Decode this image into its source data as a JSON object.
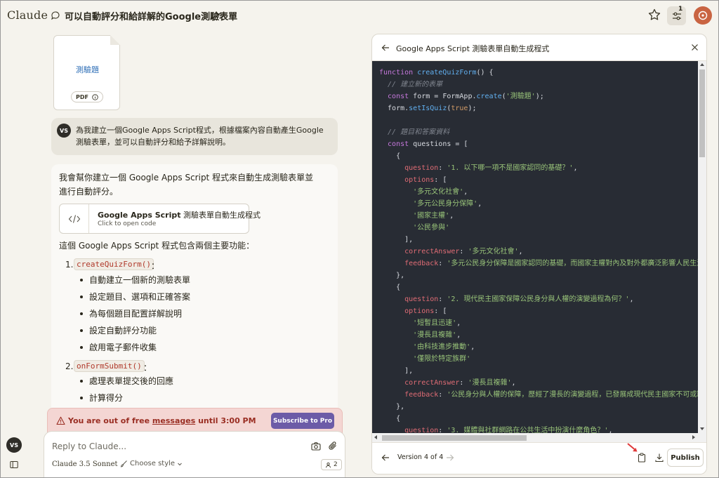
{
  "app": {
    "logo": "Claude"
  },
  "header": {
    "chat_title": "可以自動評分和給詳解的Google測驗表單",
    "settings_badge": "1"
  },
  "attachment": {
    "title": "測驗題",
    "type": "PDF"
  },
  "user": {
    "initials": "VS",
    "message": "為我建立一個Google Apps Script程式，根據檔案內容自動產生Google測驗表單，並可以自動評分和給予詳解說明。"
  },
  "assistant": {
    "intro": "我會幫你建立一個 Google Apps Script 程式來自動生成測驗表單並進行自動評分。",
    "artifact_card": {
      "title_bold": "Google Apps Script",
      "title_rest": "測驗表單自動生成程式",
      "subtitle": "Click to open code"
    },
    "features_intro": "這個 Google Apps Script 程式包含兩個主要功能：",
    "functions": [
      {
        "num": "1.",
        "name": "createQuizForm()",
        "colon": "：",
        "bullets": [
          "自動建立一個新的測驗表單",
          "設定題目、選項和正確答案",
          "為每個題目配置詳解說明",
          "設定自動評分功能",
          "啟用電子郵件收集"
        ]
      },
      {
        "num": "2.",
        "name": "onFormSubmit()",
        "colon": "：",
        "bullets": [
          "處理表單提交後的回應",
          "計算得分"
        ]
      }
    ]
  },
  "warning": {
    "before": "You are out of free ",
    "link": "messages",
    "after": " until 3:00 PM",
    "button": "Subscribe to Pro"
  },
  "composer": {
    "placeholder": "Reply to Claude...",
    "model": "Claude 3.5 Sonnet",
    "style": "Choose style",
    "count": "2"
  },
  "panel": {
    "title": "Google Apps Script 測驗表單自動生成程式",
    "version": "Version 4 of 4",
    "publish": "Publish"
  },
  "code_lines": [
    [
      [
        "k",
        "function "
      ],
      [
        "f",
        "createQuizForm"
      ],
      [
        "t",
        "() {"
      ]
    ],
    [
      [
        "c",
        "  // 建立新的表單"
      ]
    ],
    [
      [
        "k",
        "  const "
      ],
      [
        "t",
        "form = FormApp."
      ],
      [
        "f",
        "create"
      ],
      [
        "t",
        "("
      ],
      [
        "s",
        "'測驗題'"
      ],
      [
        "t",
        ");"
      ]
    ],
    [
      [
        "t",
        "  form."
      ],
      [
        "f",
        "setIsQuiz"
      ],
      [
        "t",
        "("
      ],
      [
        "b",
        "true"
      ],
      [
        "t",
        ");"
      ]
    ],
    [
      [
        "t",
        ""
      ]
    ],
    [
      [
        "c",
        "  // 題目和答案資料"
      ]
    ],
    [
      [
        "k",
        "  const "
      ],
      [
        "t",
        "questions = ["
      ]
    ],
    [
      [
        "t",
        "    {"
      ]
    ],
    [
      [
        "p",
        "      question"
      ],
      [
        "t",
        ": "
      ],
      [
        "s",
        "'1. 以下哪一項不是國家認同的基礎？'"
      ],
      [
        "t",
        ","
      ]
    ],
    [
      [
        "p",
        "      options"
      ],
      [
        "t",
        ": ["
      ]
    ],
    [
      [
        "s",
        "        '多元文化社會'"
      ],
      [
        "t",
        ","
      ]
    ],
    [
      [
        "s",
        "        '多元公民身分保障'"
      ],
      [
        "t",
        ","
      ]
    ],
    [
      [
        "s",
        "        '國家主權'"
      ],
      [
        "t",
        ","
      ]
    ],
    [
      [
        "s",
        "        '公民參與'"
      ]
    ],
    [
      [
        "t",
        "      ],"
      ]
    ],
    [
      [
        "p",
        "      correctAnswer"
      ],
      [
        "t",
        ": "
      ],
      [
        "s",
        "'多元文化社會'"
      ],
      [
        "t",
        ","
      ]
    ],
    [
      [
        "p",
        "      feedback"
      ],
      [
        "t",
        ": "
      ],
      [
        "s",
        "'多元公民身分保障是國家認同的基礎，而國家主權對內及對外都廣泛影響人民生活'"
      ]
    ],
    [
      [
        "t",
        "    },"
      ]
    ],
    [
      [
        "t",
        "    {"
      ]
    ],
    [
      [
        "p",
        "      question"
      ],
      [
        "t",
        ": "
      ],
      [
        "s",
        "'2. 現代民主國家保障公民身分與人權的演變過程為何？'"
      ],
      [
        "t",
        ","
      ]
    ],
    [
      [
        "p",
        "      options"
      ],
      [
        "t",
        ": ["
      ]
    ],
    [
      [
        "s",
        "        '短暫且迅速'"
      ],
      [
        "t",
        ","
      ]
    ],
    [
      [
        "s",
        "        '漫長且複雜'"
      ],
      [
        "t",
        ","
      ]
    ],
    [
      [
        "s",
        "        '由科技進步推動'"
      ],
      [
        "t",
        ","
      ]
    ],
    [
      [
        "s",
        "        '僅限於特定族群'"
      ]
    ],
    [
      [
        "t",
        "      ],"
      ]
    ],
    [
      [
        "p",
        "      correctAnswer"
      ],
      [
        "t",
        ": "
      ],
      [
        "s",
        "'漫長且複雜'"
      ],
      [
        "t",
        ","
      ]
    ],
    [
      [
        "p",
        "      feedback"
      ],
      [
        "t",
        ": "
      ],
      [
        "s",
        "'公民身分與人權的保障，歷經了漫長的演變過程，已發展成現代民主國家不可或缺'"
      ]
    ],
    [
      [
        "t",
        "    },"
      ]
    ],
    [
      [
        "t",
        "    {"
      ]
    ],
    [
      [
        "p",
        "      question"
      ],
      [
        "t",
        ": "
      ],
      [
        "s",
        "'3. 媒體與社群網路在公共生活中扮演什麼角色？'"
      ],
      [
        "t",
        ","
      ]
    ]
  ]
}
